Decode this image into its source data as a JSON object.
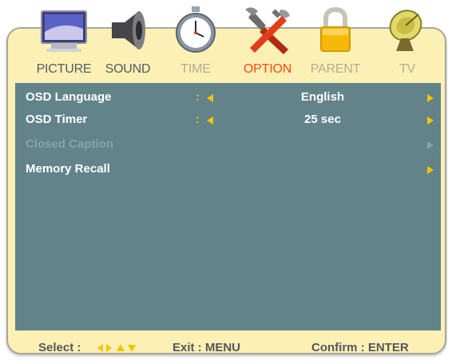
{
  "tabs": [
    {
      "id": "picture",
      "label": "PICTURE",
      "icon": "monitor-icon",
      "state": "normal"
    },
    {
      "id": "sound",
      "label": "SOUND",
      "icon": "speaker-icon",
      "state": "normal"
    },
    {
      "id": "time",
      "label": "TIME",
      "icon": "stopwatch-icon",
      "state": "dim"
    },
    {
      "id": "option",
      "label": "OPTION",
      "icon": "tools-icon",
      "state": "active"
    },
    {
      "id": "parent",
      "label": "PARENT",
      "icon": "lock-icon",
      "state": "dim"
    },
    {
      "id": "tv",
      "label": "TV",
      "icon": "satellite-dish-icon",
      "state": "dim"
    }
  ],
  "menu": {
    "rows": [
      {
        "label": "OSD Language",
        "colon": ":",
        "value": "English",
        "enabled": true
      },
      {
        "label": "OSD Timer",
        "colon": ":",
        "value": "25 sec",
        "enabled": true
      },
      {
        "label": "Closed Caption",
        "enabled": false
      },
      {
        "label": "Memory Recall",
        "enabled": true
      }
    ]
  },
  "footer": {
    "select_label": "Select :",
    "exit_label": "Exit : MENU",
    "confirm_label": "Confirm : ENTER"
  },
  "colors": {
    "frame_bg": "#fdf0b4",
    "panel_bg": "#62838a",
    "accent": "#f5c400",
    "active_tab": "#ff4a10",
    "text_light": "#ffffff",
    "text_disabled": "#8aa2a7"
  }
}
